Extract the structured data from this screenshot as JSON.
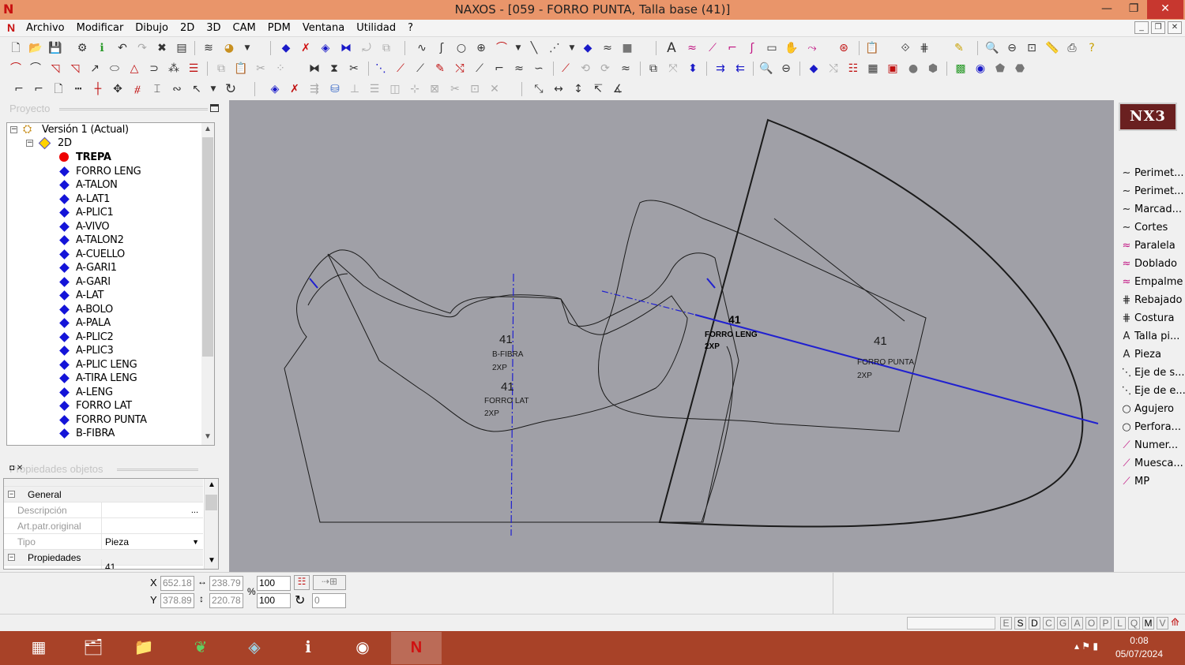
{
  "window": {
    "title": "NAXOS - [059 - FORRO PUNTA, Talla base (41)]",
    "app_icon": "N",
    "minimize": "—",
    "restore": "❐",
    "close": "✕"
  },
  "menu": {
    "items": [
      "Archivo",
      "Modificar",
      "Dibujo",
      "2D",
      "3D",
      "CAM",
      "PDM",
      "Ventana",
      "Utilidad",
      "?"
    ]
  },
  "project_panel": {
    "title": "Proyecto",
    "version": "Versión 1 (Actual)",
    "node_2d": "2D",
    "pieces": [
      {
        "name": "TREPA",
        "marker": "red-dot",
        "bold": true
      },
      {
        "name": "FORRO LENG",
        "marker": "blue-diamond"
      },
      {
        "name": "A-TALON",
        "marker": "blue-diamond"
      },
      {
        "name": "A-LAT1",
        "marker": "blue-diamond"
      },
      {
        "name": "A-PLIC1",
        "marker": "blue-diamond"
      },
      {
        "name": "A-VIVO",
        "marker": "blue-diamond"
      },
      {
        "name": "A-TALON2",
        "marker": "blue-diamond"
      },
      {
        "name": "A-CUELLO",
        "marker": "blue-diamond"
      },
      {
        "name": "A-GARI1",
        "marker": "blue-diamond"
      },
      {
        "name": "A-GARI",
        "marker": "blue-diamond"
      },
      {
        "name": "A-LAT",
        "marker": "blue-diamond"
      },
      {
        "name": "A-BOLO",
        "marker": "blue-diamond"
      },
      {
        "name": "A-PALA",
        "marker": "blue-diamond"
      },
      {
        "name": "A-PLIC2",
        "marker": "blue-diamond"
      },
      {
        "name": "A-PLIC3",
        "marker": "blue-diamond"
      },
      {
        "name": "A-PLIC LENG",
        "marker": "blue-diamond"
      },
      {
        "name": "A-TIRA LENG",
        "marker": "blue-diamond"
      },
      {
        "name": "A-LENG",
        "marker": "blue-diamond"
      },
      {
        "name": "FORRO LAT",
        "marker": "blue-diamond"
      },
      {
        "name": "FORRO PUNTA",
        "marker": "blue-diamond"
      },
      {
        "name": "B-FIBRA",
        "marker": "blue-diamond"
      }
    ]
  },
  "properties_panel": {
    "title": "Propiedades objetos",
    "general": "General",
    "descripcion_label": "Descripción",
    "descripcion_btn": "...",
    "art_label": "Art.patr.original",
    "tipo_label": "Tipo",
    "tipo_value": "Pieza",
    "propiedades": "Propiedades",
    "talla_value": "41"
  },
  "canvas": {
    "labels": {
      "size_a": "41",
      "piece_a": "B-FIBRA",
      "qty_a": "2XP",
      "size_b": "41",
      "piece_b": "FORRO LAT",
      "qty_b": "2XP",
      "size_c": "41",
      "piece_c": "FORRO LENG",
      "qty_c": "2XP",
      "size_d": "41",
      "piece_d": "FORRO PUNTA",
      "qty_d": "2XP"
    }
  },
  "right_panel": {
    "logo": "NX3",
    "tools": [
      {
        "label": "Perimet...",
        "icon": "curve-icon"
      },
      {
        "label": "Perimet...",
        "icon": "curve-icon"
      },
      {
        "label": "Marcad...",
        "icon": "curve-icon"
      },
      {
        "label": "Cortes",
        "icon": "curve-icon"
      },
      {
        "label": "Paralela",
        "icon": "parallel-curve-icon"
      },
      {
        "label": "Doblado",
        "icon": "parallel-curve-icon"
      },
      {
        "label": "Empalme",
        "icon": "parallel-curve-icon"
      },
      {
        "label": "Rebajado",
        "icon": "stitch-icon"
      },
      {
        "label": "Costura",
        "icon": "stitch-icon"
      },
      {
        "label": "Talla pi...",
        "icon": "text-icon"
      },
      {
        "label": "Pieza",
        "icon": "text-icon"
      },
      {
        "label": "Eje de s...",
        "icon": "axis-icon"
      },
      {
        "label": "Eje de e...",
        "icon": "axis-icon"
      },
      {
        "label": "Agujero",
        "icon": "circle-icon"
      },
      {
        "label": "Perfora...",
        "icon": "circle-icon"
      },
      {
        "label": "Numer...",
        "icon": "pen-icon"
      },
      {
        "label": "Muesca...",
        "icon": "pen-icon"
      },
      {
        "label": "MP",
        "icon": "pen-icon"
      }
    ]
  },
  "status": {
    "x_label": "X",
    "y_label": "Y",
    "x_value": "652.18",
    "y_value": "378.89",
    "width_value": "238.79",
    "height_value": "220.78",
    "percent_symbol": "%",
    "scale_x": "100",
    "scale_y": "100",
    "angle": "0"
  },
  "keys": [
    "E",
    "S",
    "D",
    "C",
    "G",
    "A",
    "O",
    "P",
    "L",
    "Q",
    "M",
    "V"
  ],
  "taskbar": {
    "time": "0:08",
    "date": "05/07/2024"
  }
}
